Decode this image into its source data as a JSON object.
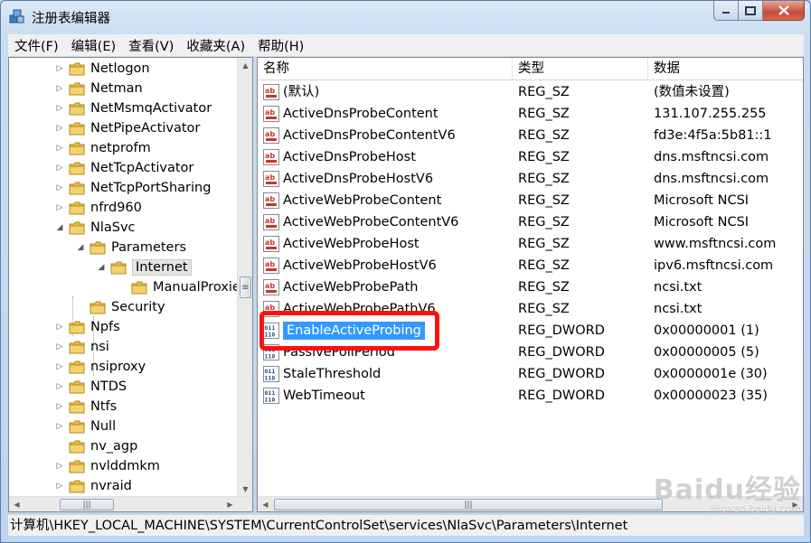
{
  "window": {
    "title": "注册表编辑器"
  },
  "menu": [
    "文件(F)",
    "编辑(E)",
    "查看(V)",
    "收藏夹(A)",
    "帮助(H)"
  ],
  "tree": [
    {
      "label": "Netlogon",
      "expander": "▷",
      "level": 0
    },
    {
      "label": "Netman",
      "expander": "▷",
      "level": 0
    },
    {
      "label": "NetMsmqActivator",
      "expander": "▷",
      "level": 0
    },
    {
      "label": "NetPipeActivator",
      "expander": "▷",
      "level": 0
    },
    {
      "label": "netprofm",
      "expander": "▷",
      "level": 0
    },
    {
      "label": "NetTcpActivator",
      "expander": "▷",
      "level": 0
    },
    {
      "label": "NetTcpPortSharing",
      "expander": "▷",
      "level": 0
    },
    {
      "label": "nfrd960",
      "expander": "▷",
      "level": 0
    },
    {
      "label": "NlaSvc",
      "expander": "◢",
      "level": 0
    },
    {
      "label": "Parameters",
      "expander": "◢",
      "level": 1
    },
    {
      "label": "Internet",
      "expander": "◢",
      "level": 2,
      "selected": true
    },
    {
      "label": "ManualProxies",
      "expander": "",
      "level": 3
    },
    {
      "label": "Security",
      "expander": "",
      "level": 1
    },
    {
      "label": "Npfs",
      "expander": "▷",
      "level": 0
    },
    {
      "label": "nsi",
      "expander": "▷",
      "level": 0
    },
    {
      "label": "nsiproxy",
      "expander": "▷",
      "level": 0
    },
    {
      "label": "NTDS",
      "expander": "▷",
      "level": 0
    },
    {
      "label": "Ntfs",
      "expander": "▷",
      "level": 0
    },
    {
      "label": "Null",
      "expander": "▷",
      "level": 0
    },
    {
      "label": "nv_agp",
      "expander": "",
      "level": 0
    },
    {
      "label": "nvlddmkm",
      "expander": "▷",
      "level": 0
    },
    {
      "label": "nvraid",
      "expander": "▷",
      "level": 0
    }
  ],
  "columns": {
    "name": "名称",
    "type": "类型",
    "data": "数据"
  },
  "values": [
    {
      "name": "(默认)",
      "type": "REG_SZ",
      "data": "(数值未设置)",
      "icon": "string-value-icon"
    },
    {
      "name": "ActiveDnsProbeContent",
      "type": "REG_SZ",
      "data": "131.107.255.255",
      "icon": "string-value-icon"
    },
    {
      "name": "ActiveDnsProbeContentV6",
      "type": "REG_SZ",
      "data": "fd3e:4f5a:5b81::1",
      "icon": "string-value-icon"
    },
    {
      "name": "ActiveDnsProbeHost",
      "type": "REG_SZ",
      "data": "dns.msftncsi.com",
      "icon": "string-value-icon"
    },
    {
      "name": "ActiveDnsProbeHostV6",
      "type": "REG_SZ",
      "data": "dns.msftncsi.com",
      "icon": "string-value-icon"
    },
    {
      "name": "ActiveWebProbeContent",
      "type": "REG_SZ",
      "data": "Microsoft NCSI",
      "icon": "string-value-icon"
    },
    {
      "name": "ActiveWebProbeContentV6",
      "type": "REG_SZ",
      "data": "Microsoft NCSI",
      "icon": "string-value-icon"
    },
    {
      "name": "ActiveWebProbeHost",
      "type": "REG_SZ",
      "data": "www.msftncsi.com",
      "icon": "string-value-icon"
    },
    {
      "name": "ActiveWebProbeHostV6",
      "type": "REG_SZ",
      "data": "ipv6.msftncsi.com",
      "icon": "string-value-icon"
    },
    {
      "name": "ActiveWebProbePath",
      "type": "REG_SZ",
      "data": "ncsi.txt",
      "icon": "string-value-icon"
    },
    {
      "name": "ActiveWebProbePathV6",
      "type": "REG_SZ",
      "data": "ncsi.txt",
      "icon": "string-value-icon"
    },
    {
      "name": "EnableActiveProbing",
      "type": "REG_DWORD",
      "data": "0x00000001 (1)",
      "icon": "binary-value-icon",
      "selected": true
    },
    {
      "name": "PassivePollPeriod",
      "type": "REG_DWORD",
      "data": "0x00000005 (5)",
      "icon": "binary-value-icon"
    },
    {
      "name": "StaleThreshold",
      "type": "REG_DWORD",
      "data": "0x0000001e (30)",
      "icon": "binary-value-icon"
    },
    {
      "name": "WebTimeout",
      "type": "REG_DWORD",
      "data": "0x00000023 (35)",
      "icon": "binary-value-icon"
    }
  ],
  "status": "计算机\\HKEY_LOCAL_MACHINE\\SYSTEM\\CurrentControlSet\\services\\NlaSvc\\Parameters\\Internet",
  "watermark": {
    "logo": "Baidu经验",
    "sub": "jingyan.baidu.com"
  },
  "colors": {
    "selection": "#3399ff",
    "highlight_box": "#ff1010",
    "folder": "#e8c04a"
  }
}
